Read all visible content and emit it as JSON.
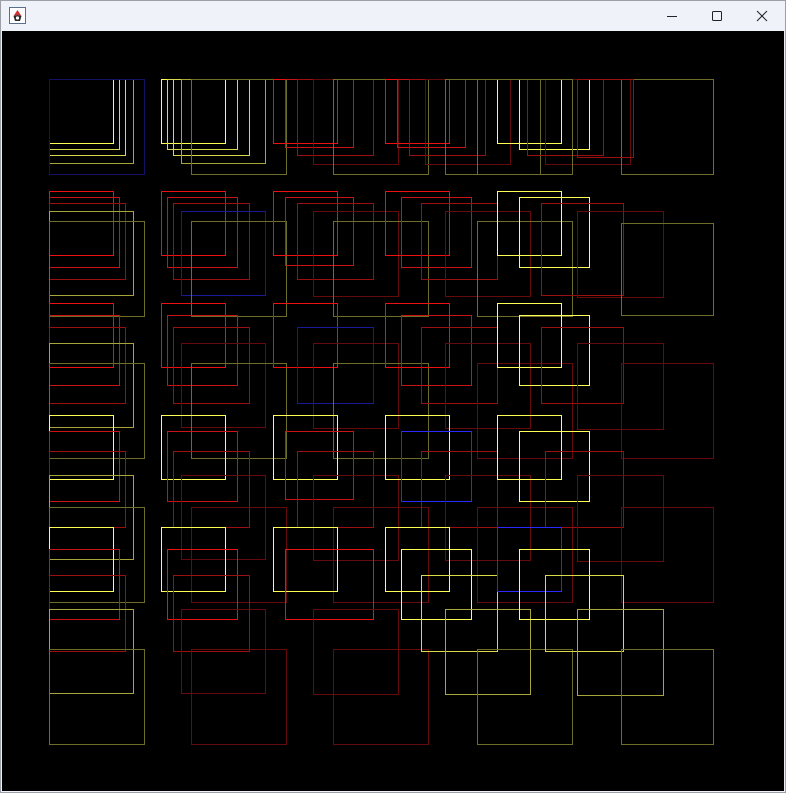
{
  "window": {
    "title": "",
    "icon": "java-duke-icon",
    "controls": [
      {
        "name": "minimize-button",
        "icon": "minimize-icon"
      },
      {
        "name": "maximize-button",
        "icon": "maximize-icon"
      },
      {
        "name": "close-button",
        "icon": "close-icon"
      }
    ]
  },
  "canvas": {
    "background": "#000000",
    "colors": {
      "Y": "#ffff55",
      "y2": "#d9d94a",
      "y3": "#a6a63a",
      "y4": "#6e6e2a",
      "R": "#ee1111",
      "r2": "#c81414",
      "r3": "#9a1010",
      "r4": "#650b0b",
      "B": "#2a2aff",
      "b3": "#1a1a99",
      "b4": "#111166"
    }
  }
}
